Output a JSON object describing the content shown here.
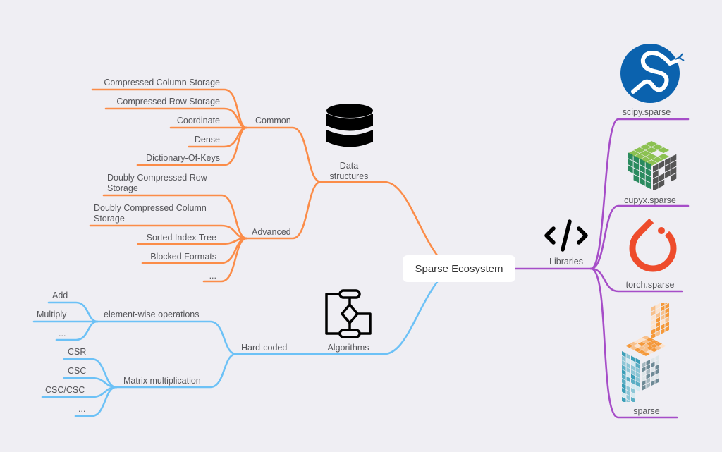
{
  "root": {
    "label": "Sparse Ecosystem"
  },
  "colors": {
    "data_structures": "#fb8c48",
    "algorithms": "#6cc1f6",
    "libraries": "#a64dc8",
    "background": "#efeef3"
  },
  "data_structures": {
    "label": "Data structures",
    "icon": "database-icon",
    "common": {
      "label": "Common",
      "items": [
        "Compressed Column Storage",
        "Compressed Row Storage",
        "Coordinate",
        "Dense",
        "Dictionary-Of-Keys"
      ]
    },
    "advanced": {
      "label": "Advanced",
      "items": [
        "Doubly Compressed Row Storage",
        "Doubly Compressed Column Storage",
        "Sorted Index Tree",
        "Blocked Formats",
        "..."
      ]
    }
  },
  "algorithms": {
    "label": "Algorithms",
    "icon": "flowchart-icon",
    "hard_coded": {
      "label": "Hard-coded",
      "elementwise": {
        "label": "element-wise operations",
        "items": [
          "Add",
          "Multiply",
          "..."
        ]
      },
      "matmul": {
        "label": "Matrix multiplication",
        "items": [
          "CSR",
          "CSC",
          "CSC/CSC",
          "..."
        ]
      }
    }
  },
  "libraries": {
    "label": "Libraries",
    "icon": "code-icon",
    "items": [
      {
        "label": "scipy.sparse",
        "icon": "scipy-logo-icon"
      },
      {
        "label": "cupyx.sparse",
        "icon": "cupy-logo-icon"
      },
      {
        "label": "torch.sparse",
        "icon": "pytorch-logo-icon"
      },
      {
        "label": "sparse",
        "icon": "pydata-sparse-logo-icon"
      }
    ]
  }
}
